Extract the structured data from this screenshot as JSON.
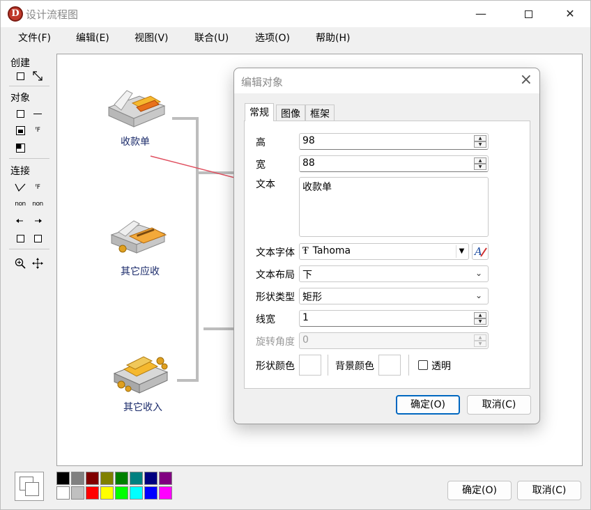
{
  "window": {
    "app_icon_letter": "D",
    "title": "设计流程图"
  },
  "menu": [
    "文件(F)",
    "编辑(E)",
    "视图(V)",
    "联合(U)",
    "选项(O)",
    "帮助(H)"
  ],
  "toolbox": {
    "create_label": "创建",
    "object_label": "对象",
    "connect_label": "连接",
    "fx_text": "ᶠF",
    "non_text": "non"
  },
  "canvas": {
    "nodes": [
      "收款单",
      "其它应收",
      "其它收入"
    ]
  },
  "colors": {
    "palette_row1": [
      "#000000",
      "#808080",
      "#800000",
      "#808000",
      "#008000",
      "#008080",
      "#000080",
      "#800080"
    ],
    "palette_row2": [
      "#ffffff",
      "#c0c0c0",
      "#ff0000",
      "#ffff00",
      "#00ff00",
      "#00ffff",
      "#0000ff",
      "#ff00ff"
    ],
    "accent": "#0067c0"
  },
  "main_buttons": {
    "ok": "确定(O)",
    "cancel": "取消(C)"
  },
  "dialog": {
    "title": "编辑对象",
    "tabs": [
      "常规",
      "图像",
      "框架"
    ],
    "labels": {
      "height": "高",
      "width": "宽",
      "text": "文本",
      "font": "文本字体",
      "layout": "文本布局",
      "shape": "形状类型",
      "line_width": "线宽",
      "rotation": "旋转角度",
      "shape_color": "形状颜色",
      "bg_color": "背景颜色",
      "transparent": "透明"
    },
    "values": {
      "height": "98",
      "width": "88",
      "text": "收款单",
      "font": "Tahoma",
      "layout": "下",
      "shape": "矩形",
      "line_width": "1",
      "rotation": "0"
    },
    "ok": "确定(O)",
    "cancel": "取消(C)"
  }
}
